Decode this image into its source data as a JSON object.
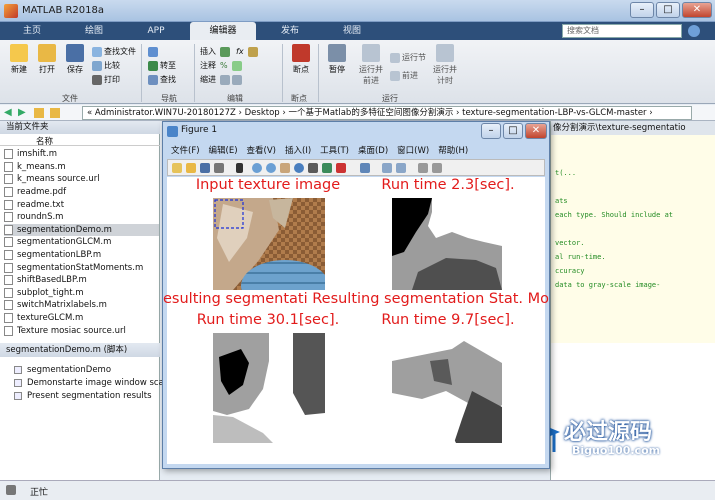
{
  "window": {
    "title": "MATLAB R2018a",
    "min": "–",
    "max": "□",
    "close": "✕"
  },
  "tabs": [
    "主页",
    "绘图",
    "APP",
    "编辑器",
    "发布",
    "视图"
  ],
  "search": {
    "placeholder": "搜索文档"
  },
  "ribbon": {
    "file_group": {
      "label": "文件",
      "new": "新建",
      "open": "打开",
      "save": "保存",
      "find_files": "查找文件",
      "compare": "比较",
      "print": "打印"
    },
    "nav_group": {
      "label": "导航",
      "goto": "转至",
      "find": "查找"
    },
    "edit_group": {
      "label": "编辑",
      "insert": "插入",
      "comment": "注释",
      "indent": "缩进"
    },
    "breakpoint_group": {
      "label": "断点",
      "breakpoints": "断点"
    },
    "run_group": {
      "label": "运行",
      "pause": "暂停",
      "run_advance": "运行并\n前进",
      "run_section": "运行节",
      "advance": "前进",
      "run_time": "运行并\n计时"
    }
  },
  "address": {
    "path": "« Administrator.WIN7U-20180127Z › Desktop › 一个基于Matlab的多特征空间图像分割演示 › texture-segmentation-LBP-vs-GLCM-master ›"
  },
  "current_folder": {
    "title": "当前文件夹",
    "column": "名称",
    "files": [
      {
        "name": "imshift.m",
        "selected": false
      },
      {
        "name": "k_means.m",
        "selected": false
      },
      {
        "name": "k_means source.url",
        "selected": false
      },
      {
        "name": "readme.pdf",
        "selected": false
      },
      {
        "name": "readme.txt",
        "selected": false
      },
      {
        "name": "roundnS.m",
        "selected": false
      },
      {
        "name": "segmentationDemo.m",
        "selected": true
      },
      {
        "name": "segmentationGLCM.m",
        "selected": false
      },
      {
        "name": "segmentationLBP.m",
        "selected": false
      },
      {
        "name": "segmentationStatMoments.m",
        "selected": false
      },
      {
        "name": "shiftBasedLBP.m",
        "selected": false
      },
      {
        "name": "subplot_tight.m",
        "selected": false
      },
      {
        "name": "switchMatrixlabels.m",
        "selected": false
      },
      {
        "name": "textureGLCM.m",
        "selected": false
      },
      {
        "name": "Texture mosiac source.url",
        "selected": false
      }
    ]
  },
  "details": {
    "title": "segmentationDemo.m  (脚本)",
    "items": [
      "segmentationDemo",
      "Demonstarte image window scan.",
      "Present segmentation results"
    ]
  },
  "editor": {
    "tab": "像分割演示\\texture-segmentatio",
    "lines": [
      "t(...",
      "ats",
      "each type. Should include at",
      "",
      "vector.",
      "al run-time.",
      "ccuracy",
      "data to gray-scale image-"
    ]
  },
  "figure": {
    "title": "Figure 1",
    "menu": [
      "文件(F)",
      "编辑(E)",
      "查看(V)",
      "插入(I)",
      "工具(T)",
      "桌面(D)",
      "窗口(W)",
      "帮助(H)"
    ],
    "panels": [
      {
        "title": "Input texture image"
      },
      {
        "title": "Run time 2.3[sec]."
      },
      {
        "title": "esulting segmentati Resulting segmentation Stat. Mom"
      },
      {
        "subtitle_left": "Run time 30.1[sec].",
        "subtitle_right": "Run time 9.7[sec]."
      }
    ]
  },
  "watermark": {
    "title": "必过源码",
    "url": "Biguo100.com"
  },
  "status": {
    "text": "正忙"
  }
}
